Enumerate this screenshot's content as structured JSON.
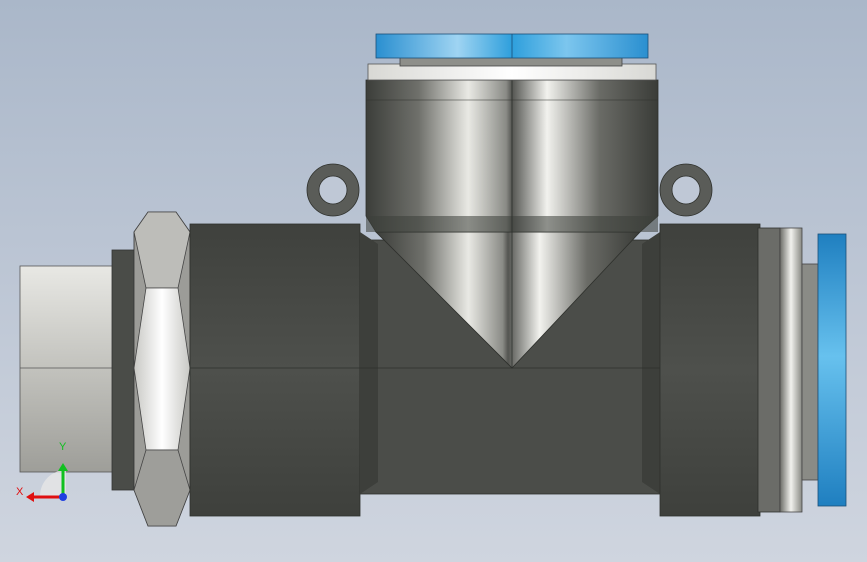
{
  "view": {
    "background_top": "#aab7c9",
    "background_bottom": "#cfd5df"
  },
  "model": {
    "type": "tee push-in fitting with threaded branch and hex nut",
    "colors": {
      "body": "#4e504c",
      "collet": "#3f9fd6",
      "chrome": "#e8e8e4",
      "nut": "#cfcfcc"
    }
  },
  "triad": {
    "x_label": "X",
    "y_label": "Y",
    "x_color": "#e01010",
    "y_color": "#10c020",
    "z_color": "#2040e0"
  }
}
